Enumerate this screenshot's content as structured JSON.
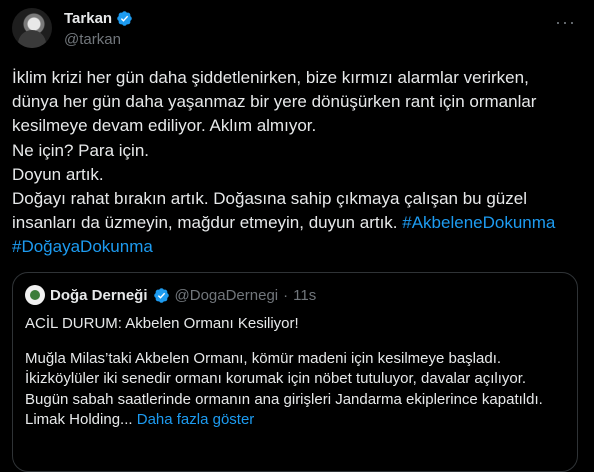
{
  "author": {
    "display_name": "Tarkan",
    "handle": "@tarkan",
    "verified_icon": "verified-badge-icon",
    "more_icon": "more-icon"
  },
  "tweet": {
    "lines": [
      "İklim krizi her gün daha şiddetlenirken, bize kırmızı alarmlar verirken,",
      "dünya her gün daha yaşanmaz bir yere dönüşürken rant için ormanlar",
      "kesilmeye devam ediliyor. Aklım almıyor.",
      "Ne için? Para için.",
      "Doyun artık.",
      "Doğayı rahat bırakın artık. Doğasına sahip çıkmaya çalışan bu güzel",
      "insanları da üzmeyin, mağdur etmeyin, duyun artık."
    ],
    "hashtag_1": "#AkbeleneDokunma",
    "hashtag_2": "#DoğayaDokunma"
  },
  "quote": {
    "display_name": "Doğa Derneği",
    "handle": "@DogaDernegi",
    "separator": "·",
    "time": "11s",
    "title": "ACİL DURUM: Akbelen Ormanı Kesiliyor!",
    "body_lines": [
      "Muğla Milas’taki Akbelen Ormanı, kömür madeni için kesilmeye başladı.",
      "İkizköylüler iki senedir ormanı korumak için nöbet tutuluyor, davalar açılıyor.",
      "Bugün sabah saatlerinde ormanın ana girişleri Jandarma ekiplerince kapatıldı."
    ],
    "last_line": "Limak Holding...",
    "show_more": "Daha fazla göster"
  },
  "colors": {
    "background": "#000000",
    "text": "#e7e9ea",
    "secondary": "#71767b",
    "accent": "#1d9bf0",
    "border": "#2f3336"
  }
}
